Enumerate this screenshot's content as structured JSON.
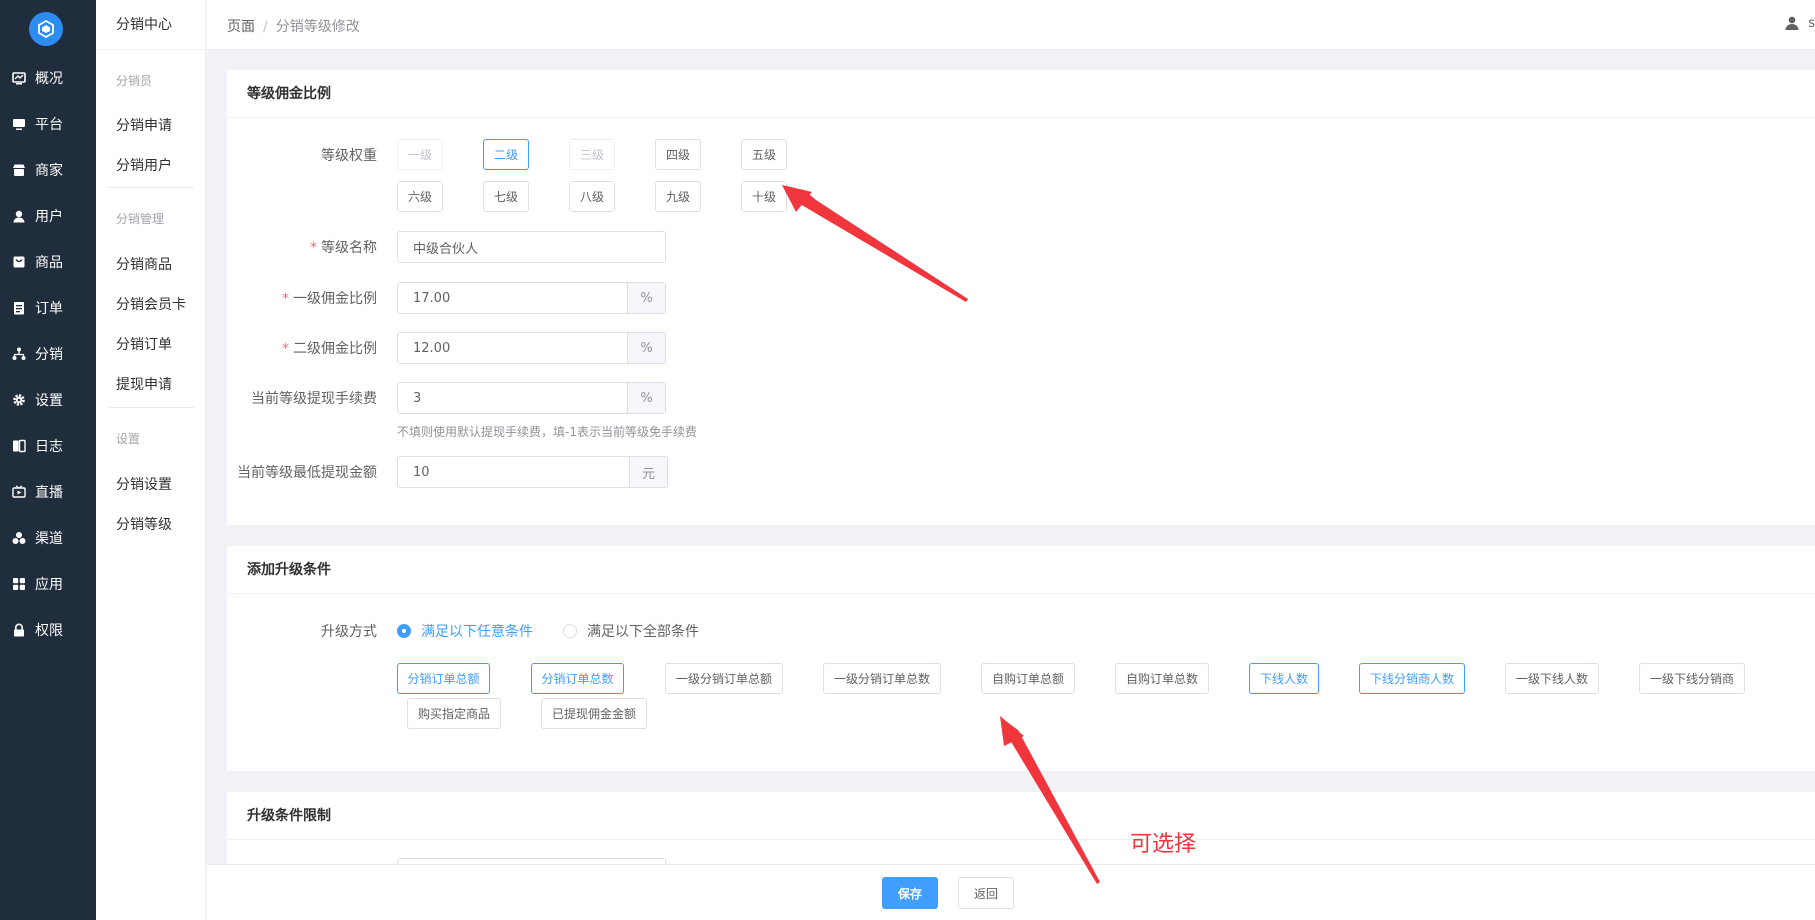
{
  "nav": {
    "items": [
      {
        "label": "概况",
        "icon": "dashboard-icon"
      },
      {
        "label": "平台",
        "icon": "monitor-icon"
      },
      {
        "label": "商家",
        "icon": "store-icon"
      },
      {
        "label": "用户",
        "icon": "user-icon"
      },
      {
        "label": "商品",
        "icon": "goods-icon"
      },
      {
        "label": "订单",
        "icon": "order-icon"
      },
      {
        "label": "分销",
        "icon": "distribution-icon"
      },
      {
        "label": "设置",
        "icon": "gear-icon"
      },
      {
        "label": "日志",
        "icon": "log-icon"
      },
      {
        "label": "直播",
        "icon": "live-icon"
      },
      {
        "label": "渠道",
        "icon": "channel-icon"
      },
      {
        "label": "应用",
        "icon": "apps-icon"
      },
      {
        "label": "权限",
        "icon": "lock-icon"
      }
    ]
  },
  "subnav": {
    "title": "分销中心",
    "groups": [
      {
        "label": "分销员",
        "links": [
          "分销申请",
          "分销用户"
        ]
      },
      {
        "label": "分销管理",
        "links": [
          "分销商品",
          "分销会员卡",
          "分销订单",
          "提现申请"
        ]
      },
      {
        "label": "设置",
        "links": [
          "分销设置",
          "分销等级"
        ]
      }
    ]
  },
  "header": {
    "crumb_root": "页面",
    "crumb_sep": "/",
    "crumb_current": "分销等级修改",
    "user_initial": "s"
  },
  "commission": {
    "title": "等级佣金比例",
    "weight_label": "等级权重",
    "levels": [
      {
        "label": "一级",
        "state": "disabled"
      },
      {
        "label": "二级",
        "state": "active"
      },
      {
        "label": "三级",
        "state": "disabled"
      },
      {
        "label": "四级",
        "state": "normal"
      },
      {
        "label": "五级",
        "state": "normal"
      },
      {
        "label": "六级",
        "state": "normal"
      },
      {
        "label": "七级",
        "state": "normal"
      },
      {
        "label": "八级",
        "state": "normal"
      },
      {
        "label": "九级",
        "state": "normal"
      },
      {
        "label": "十级",
        "state": "normal"
      }
    ],
    "required_mark": "*",
    "name_label": "等级名称",
    "name_value": "中级合伙人",
    "first_label": "一级佣金比例",
    "first_value": "17.00",
    "second_label": "二级佣金比例",
    "second_value": "12.00",
    "fee_label": "当前等级提现手续费",
    "fee_value": "3",
    "percent": "%",
    "fee_hint": "不填则使用默认提现手续费，填-1表示当前等级免手续费",
    "min_label": "当前等级最低提现金额",
    "min_value": "10",
    "yuan": "元"
  },
  "upgrade": {
    "title": "添加升级条件",
    "mode_label": "升级方式",
    "mode_any": "满足以下任意条件",
    "mode_all": "满足以下全部条件",
    "conditions": [
      {
        "label": "分销订单总额",
        "active": true
      },
      {
        "label": "分销订单总数",
        "active": true
      },
      {
        "label": "一级分销订单总额",
        "active": false
      },
      {
        "label": "一级分销订单总数",
        "active": false
      },
      {
        "label": "自购订单总额",
        "active": false
      },
      {
        "label": "自购订单总数",
        "active": false
      },
      {
        "label": "下线人数",
        "active": true
      },
      {
        "label": "下线分销商人数",
        "active": true
      },
      {
        "label": "一级下线人数",
        "active": false
      },
      {
        "label": "一级下线分销商",
        "active": false
      },
      {
        "label": "购买指定商品",
        "active": false
      },
      {
        "label": "已提现佣金金额",
        "active": false
      }
    ]
  },
  "limits": {
    "title": "升级条件限制"
  },
  "footer": {
    "save": "保存",
    "back": "返回"
  },
  "annotation": {
    "text": "可选择",
    "color": "#f0353d"
  },
  "colors": {
    "primary": "#409eff",
    "nav_bg": "#1f2d3d"
  }
}
